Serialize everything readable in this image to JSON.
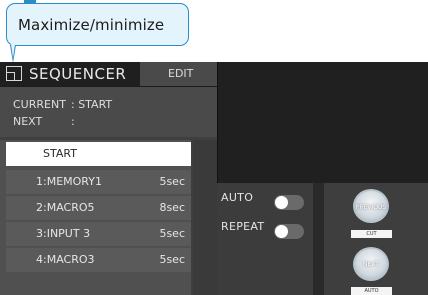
{
  "callout": {
    "text": "Maximize/minimize"
  },
  "sequencer": {
    "title": "SEQUENCER",
    "edit_label": "EDIT",
    "current_label": "CURRENT",
    "current_value": ": START",
    "next_label": "NEXT",
    "next_value": ":",
    "list": [
      {
        "label": "START",
        "duration": "",
        "active": true
      },
      {
        "label": "1:MEMORY1",
        "duration": "5sec"
      },
      {
        "label": "2:MACRO5",
        "duration": "8sec"
      },
      {
        "label": "3:INPUT 3",
        "duration": "5sec"
      },
      {
        "label": "4:MACRO3",
        "duration": "5sec"
      }
    ]
  },
  "toggles": {
    "auto_label": "AUTO",
    "repeat_label": "REPEAT",
    "auto_on": false,
    "repeat_on": false
  },
  "transition": {
    "previous_label": "PREVIOUS",
    "cut_label": "CUT",
    "next_label": "NEXT",
    "auto_label": "AUTO"
  },
  "colors": {
    "callout_border": "#2c8cc8",
    "callout_fill": "#e3f4fc",
    "panel_dark": "#1f1f1f"
  }
}
